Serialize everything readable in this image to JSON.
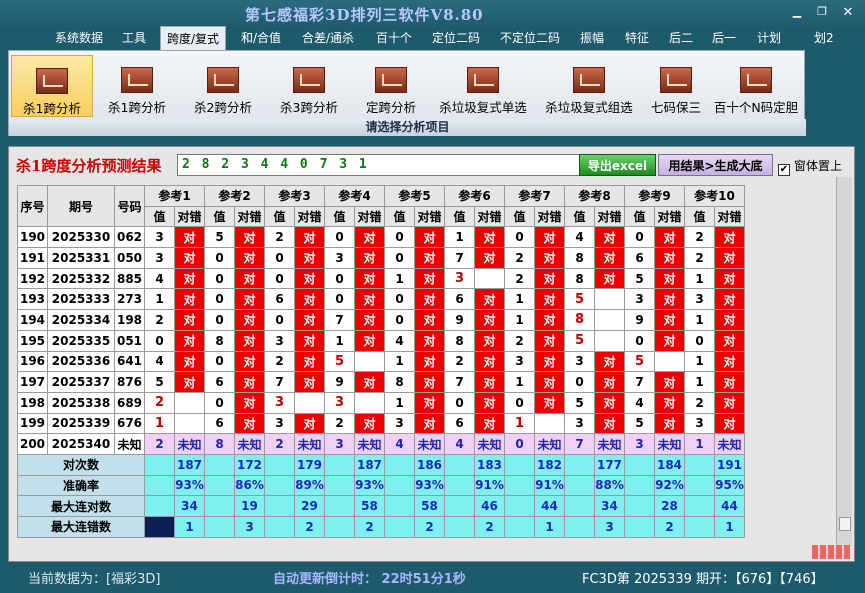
{
  "window": {
    "title": "第七感福彩3D排列三软件V8.80"
  },
  "menu": [
    "系统数据",
    "工具",
    "跨度/复式",
    "和/合值",
    "合差/通杀",
    "百十个",
    "定位二码",
    "不定位二码",
    "振幅",
    "特征",
    "后二",
    "后一",
    "计划",
    "划2"
  ],
  "ribbon": {
    "buttons": [
      "杀1跨分析",
      "杀1跨分析",
      "杀2跨分析",
      "杀3跨分析",
      "定跨分析",
      "杀垃圾复式单选",
      "杀垃圾复式组选",
      "七码保三",
      "百十个N码定胆"
    ],
    "caption": "请选择分析项目"
  },
  "panel": {
    "heading": "杀1跨度分析预测结果",
    "result": "2 8 2 3 4 4 0 7 3 1",
    "export_label": "导出excel",
    "generate_label": "用结果>生成大底",
    "checkbox_label": "窗体置上"
  },
  "table": {
    "col_headers": [
      "序号",
      "期号",
      "号码"
    ],
    "ref_headers": [
      "参考1",
      "参考2",
      "参考3",
      "参考4",
      "参考5",
      "参考6",
      "参考7",
      "参考8",
      "参考9",
      "参考10"
    ],
    "sub_value": "值",
    "sub_check": "对错",
    "correct_mark": "对",
    "rows": [
      {
        "seq": "190",
        "period": "2025330",
        "num": "062",
        "vals": [
          "3",
          "5",
          "2",
          "0",
          "0",
          "1",
          "0",
          "4",
          "0",
          "2"
        ],
        "ok": [
          1,
          1,
          1,
          1,
          1,
          1,
          1,
          1,
          1,
          1
        ]
      },
      {
        "seq": "191",
        "period": "2025331",
        "num": "050",
        "vals": [
          "3",
          "0",
          "0",
          "3",
          "0",
          "7",
          "2",
          "8",
          "6",
          "2"
        ],
        "ok": [
          1,
          1,
          1,
          1,
          1,
          1,
          1,
          1,
          1,
          1
        ]
      },
      {
        "seq": "192",
        "period": "2025332",
        "num": "885",
        "vals": [
          "4",
          "0",
          "0",
          "0",
          "1",
          "3",
          "2",
          "8",
          "5",
          "1"
        ],
        "ok": [
          1,
          1,
          1,
          1,
          1,
          0,
          1,
          1,
          1,
          1
        ]
      },
      {
        "seq": "193",
        "period": "2025333",
        "num": "273",
        "vals": [
          "1",
          "0",
          "6",
          "0",
          "0",
          "6",
          "1",
          "5",
          "3",
          "3"
        ],
        "ok": [
          1,
          1,
          1,
          1,
          1,
          1,
          1,
          0,
          1,
          1
        ]
      },
      {
        "seq": "194",
        "period": "2025334",
        "num": "198",
        "vals": [
          "2",
          "0",
          "0",
          "7",
          "0",
          "9",
          "1",
          "8",
          "9",
          "1"
        ],
        "ok": [
          1,
          1,
          1,
          1,
          1,
          1,
          1,
          0,
          1,
          1
        ]
      },
      {
        "seq": "195",
        "period": "2025335",
        "num": "051",
        "vals": [
          "0",
          "8",
          "3",
          "1",
          "4",
          "8",
          "2",
          "5",
          "0",
          "0"
        ],
        "ok": [
          1,
          1,
          1,
          1,
          1,
          1,
          1,
          0,
          1,
          1
        ]
      },
      {
        "seq": "196",
        "period": "2025336",
        "num": "641",
        "vals": [
          "4",
          "0",
          "2",
          "5",
          "1",
          "2",
          "3",
          "3",
          "5",
          "1"
        ],
        "ok": [
          1,
          1,
          1,
          0,
          1,
          1,
          1,
          1,
          0,
          1
        ]
      },
      {
        "seq": "197",
        "period": "2025337",
        "num": "876",
        "vals": [
          "5",
          "6",
          "7",
          "9",
          "8",
          "7",
          "1",
          "0",
          "7",
          "1"
        ],
        "ok": [
          1,
          1,
          1,
          1,
          1,
          1,
          1,
          1,
          1,
          1
        ]
      },
      {
        "seq": "198",
        "period": "2025338",
        "num": "689",
        "vals": [
          "2",
          "0",
          "3",
          "3",
          "1",
          "0",
          "0",
          "5",
          "4",
          "2"
        ],
        "ok": [
          0,
          1,
          0,
          0,
          1,
          1,
          1,
          1,
          1,
          1
        ]
      },
      {
        "seq": "199",
        "period": "2025339",
        "num": "676",
        "vals": [
          "1",
          "6",
          "3",
          "2",
          "3",
          "6",
          "1",
          "3",
          "5",
          "3"
        ],
        "ok": [
          0,
          1,
          1,
          1,
          1,
          1,
          0,
          1,
          1,
          1
        ]
      },
      {
        "seq": "200",
        "period": "2025340",
        "num": "未知",
        "vals": [
          "2",
          "8",
          "2",
          "3",
          "4",
          "4",
          "0",
          "7",
          "3",
          "1"
        ],
        "unknown": "未知"
      }
    ],
    "stats": [
      {
        "label": "对次数",
        "values": [
          "187",
          "172",
          "179",
          "187",
          "186",
          "183",
          "182",
          "177",
          "184",
          "191"
        ]
      },
      {
        "label": "准确率",
        "values": [
          "93%",
          "86%",
          "89%",
          "93%",
          "93%",
          "91%",
          "91%",
          "88%",
          "92%",
          "95%"
        ]
      },
      {
        "label": "最大连对数",
        "values": [
          "34",
          "19",
          "29",
          "58",
          "58",
          "46",
          "44",
          "34",
          "28",
          "44"
        ]
      },
      {
        "label": "最大连错数",
        "values": [
          "1",
          "3",
          "2",
          "2",
          "2",
          "2",
          "1",
          "3",
          "2",
          "1"
        ]
      }
    ]
  },
  "status": {
    "current": "当前数据为：[福彩3D]",
    "countdown": "自动更新倒计时：  22时51分1秒",
    "period": "FC3D第 2025339 期开：【676】【746】"
  },
  "colors": {
    "correct": "#ee0000",
    "unknown": "#f0d0f4",
    "stats": "#7ff0f0"
  }
}
